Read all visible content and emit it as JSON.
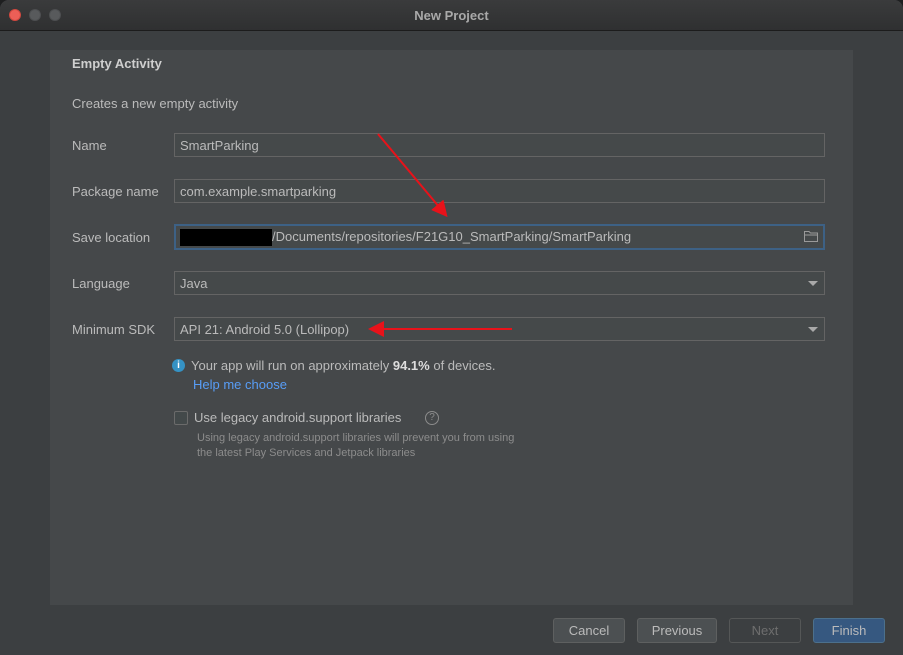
{
  "window": {
    "title": "New Project"
  },
  "header": {
    "title": "Empty Activity",
    "description": "Creates a new empty activity"
  },
  "form": {
    "name": {
      "label": "Name",
      "value": "SmartParking"
    },
    "package": {
      "label": "Package name",
      "value": "com.example.smartparking"
    },
    "save_location": {
      "label": "Save location",
      "value": "/Documents/repositories/F21G10_SmartParking/SmartParking"
    },
    "language": {
      "label": "Language",
      "value": "Java"
    },
    "min_sdk": {
      "label": "Minimum SDK",
      "value": "API 21: Android 5.0 (Lollipop)"
    }
  },
  "info": {
    "prefix": "Your app will run on approximately ",
    "percent": "94.1%",
    "suffix": " of devices.",
    "help_link": "Help me choose"
  },
  "legacy": {
    "checkbox_label": "Use legacy android.support libraries",
    "checked": false,
    "help_icon": "?",
    "note_line1": "Using legacy android.support libraries will prevent you from using",
    "note_line2": "the latest Play Services and Jetpack libraries"
  },
  "footer": {
    "cancel": "Cancel",
    "previous": "Previous",
    "next": "Next",
    "finish": "Finish"
  },
  "icons": {
    "close": "close-icon",
    "minimize": "minimize-icon",
    "zoom": "zoom-icon",
    "folder": "folder-icon",
    "dropdown": "chevron-down-icon",
    "info": "info-icon",
    "help": "question-icon"
  },
  "colors": {
    "accent_link": "#589df6",
    "finish_button": "#365880",
    "annotation_arrow": "#e8121a"
  }
}
